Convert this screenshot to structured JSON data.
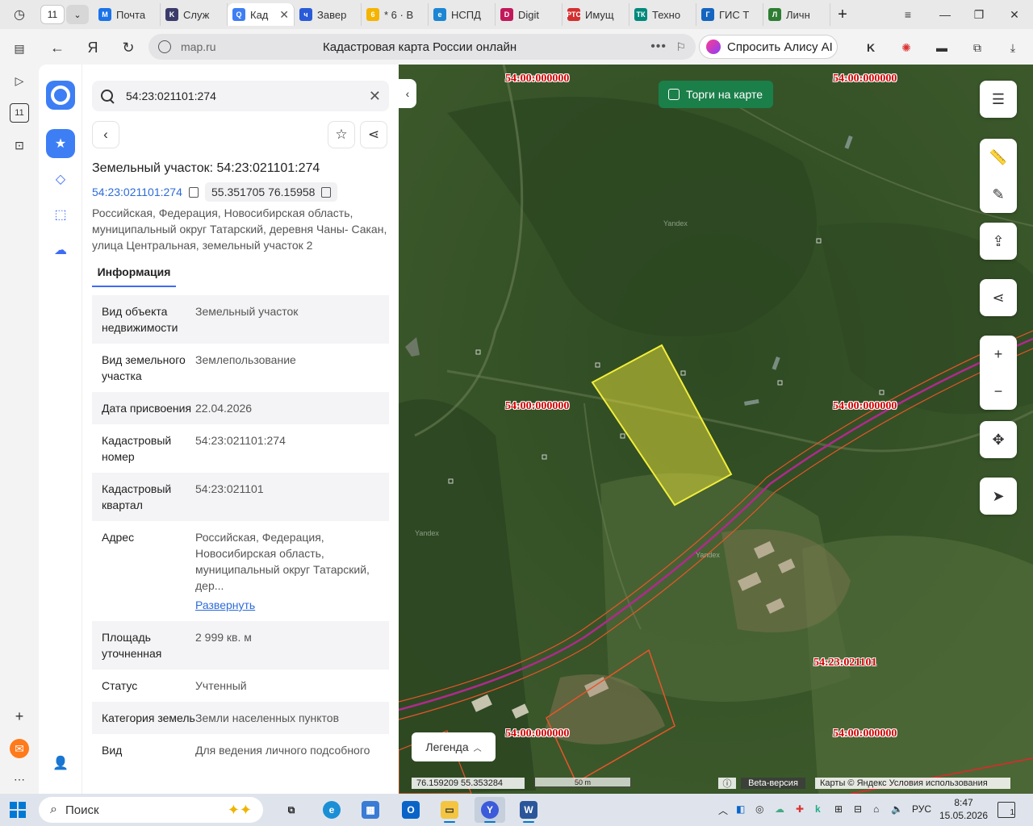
{
  "browser": {
    "tab_count": "11",
    "tabs": [
      {
        "label": "Почта",
        "fav_color": "#1a73e8",
        "fav_text": "М"
      },
      {
        "label": "Служ",
        "fav_color": "#3b3b6b",
        "fav_text": "K"
      },
      {
        "label": "Кад",
        "fav_color": "#3d7ef5",
        "fav_text": "Q",
        "active": true
      },
      {
        "label": "Завер",
        "fav_color": "#2a5bd7",
        "fav_text": "ч"
      },
      {
        "label": "* 6 · В",
        "fav_color": "#f5b400",
        "fav_text": "6"
      },
      {
        "label": "НСПД",
        "fav_color": "#1c86d4",
        "fav_text": "e"
      },
      {
        "label": "Digit",
        "fav_color": "#c2185b",
        "fav_text": "D"
      },
      {
        "label": "Имущ",
        "fav_color": "#d32f2f",
        "fav_text": "РТС"
      },
      {
        "label": "Техно",
        "fav_color": "#00897b",
        "fav_text": "ТК"
      },
      {
        "label": "ГИС Т",
        "fav_color": "#1565c0",
        "fav_text": "Г"
      },
      {
        "label": "Личн",
        "fav_color": "#2e7d32",
        "fav_text": "Л"
      }
    ],
    "address": {
      "domain": "map.ru",
      "page_title": "Кадастровая карта России онлайн"
    },
    "alice_label": "Спросить Алису AI"
  },
  "search": {
    "value": "54:23:021101:274"
  },
  "parcel": {
    "title": "Земельный участок: 54:23:021101:274",
    "cadastral_link": "54:23:021101:274",
    "coordinates": "55.351705 76.15958",
    "address_full": "Российская, Федерация, Новосибирская область, муниципальный округ Татарский, деревня Чаны- Сакан, улица Центральная, земельный участок 2",
    "tab_info": "Информация",
    "rows": [
      {
        "key": "Вид объекта недвижимости",
        "value": "Земельный участок"
      },
      {
        "key": "Вид земельного участка",
        "value": "Землепользование"
      },
      {
        "key": "Дата присвоения",
        "value": "22.04.2026"
      },
      {
        "key": "Кадастровый номер",
        "value": "54:23:021101:274"
      },
      {
        "key": "Кадастровый квартал",
        "value": "54:23:021101"
      },
      {
        "key": "Адрес",
        "value": "Российская, Федерация, Новосибирская область, муниципальный округ Татарский, дер...",
        "link": "Развернуть"
      },
      {
        "key": "Площадь уточненная",
        "value": "2 999 кв. м"
      },
      {
        "key": "Статус",
        "value": "Учтенный"
      },
      {
        "key": "Категория земель",
        "value": "Земли населенных пунктов"
      },
      {
        "key": "Вид",
        "value": "Для ведения личного подсобного"
      }
    ]
  },
  "map": {
    "torgi_label": "Торги на карте",
    "legend_label": "Легенда",
    "coords_readout": "76.159209  55.353284",
    "scale_label": "50 m",
    "beta_label": "Beta-версия",
    "attribution": "Карты © Яндекс  Условия использования",
    "watermark": "Yandex",
    "cad_labels": [
      "54:00:000000",
      "54:00:000000",
      "54:00:000000",
      "54:00:000000",
      "54:23:021101",
      "54:00:000000",
      "54:00:000000"
    ],
    "parcel_fill": "#e8e23a",
    "boundary_color": "#e8552a",
    "road_color": "#b02a8c"
  },
  "taskbar": {
    "search_label": "Поиск",
    "lang": "РУС",
    "time": "8:47",
    "date": "15.05.2026",
    "notifications": "1"
  }
}
